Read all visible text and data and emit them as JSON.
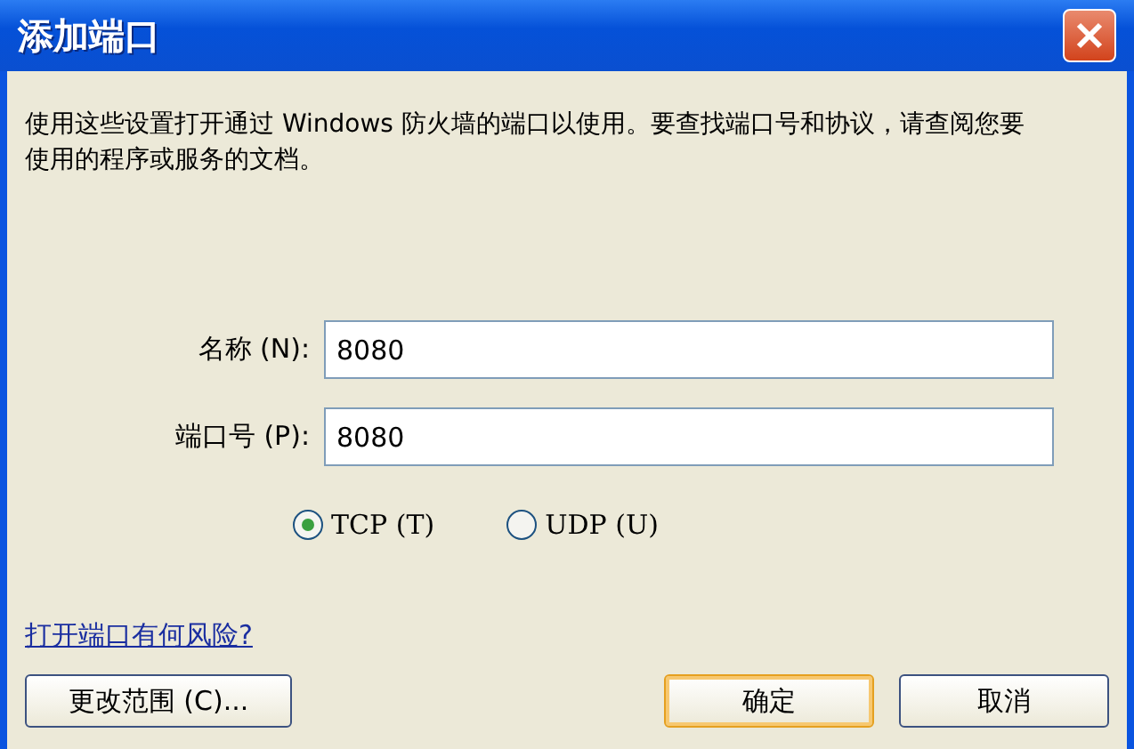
{
  "window": {
    "title": "添加端口"
  },
  "description": "使用这些设置打开通过 Windows 防火墙的端口以使用。要查找端口号和协议，请查阅您要使用的程序或服务的文档。",
  "fields": [
    {
      "label": "名称 (N):",
      "value": "8080"
    },
    {
      "label": "端口号 (P):",
      "value": "8080"
    }
  ],
  "protocols": [
    {
      "label": "TCP (T)",
      "selected": true
    },
    {
      "label": "UDP (U)",
      "selected": false
    }
  ],
  "link": "打开端口有何风险?",
  "buttons": [
    {
      "label": "更改范围 (C)...",
      "default": false
    },
    {
      "label": "确定",
      "default": true
    },
    {
      "label": "取消",
      "default": false
    }
  ]
}
